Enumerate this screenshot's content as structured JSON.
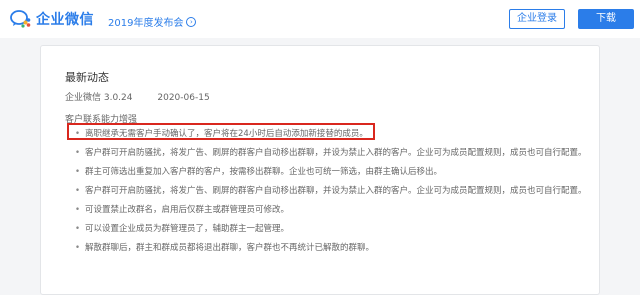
{
  "header": {
    "logo_text": "企业微信",
    "year_link": "2019年度发布会",
    "login_label": "企业登录",
    "download_label": "下载"
  },
  "card": {
    "title": "最新动态",
    "version": "企业微信 3.0.24",
    "date": "2020-06-15",
    "section": "客户联系能力增强",
    "items": [
      "离职继承无需客户手动确认了，客户将在24小时后自动添加新接替的成员。",
      "客户群可开启防骚扰，将发广告、刷屏的群客户自动移出群聊，并设为禁止入群的客户。企业可为成员配置规则，成员也可自行配置。",
      "群主可筛选出重复加入客户群的客户，按需移出群聊。企业也可统一筛选，由群主确认后移出。",
      "客户群可开启防骚扰，将发广告、刷屏的群客户自动移出群聊，并设为禁止入群的客户。企业可为成员配置规则，成员也可自行配置。",
      "可设置禁止改群名，启用后仅群主或群管理员可修改。",
      "可以设置企业成员为群管理员了，辅助群主一起管理。",
      "解散群聊后，群主和群成员都将退出群聊，客户群也不再统计已解散的群聊。"
    ]
  },
  "colors": {
    "brand": "#2b7de9",
    "highlight": "#d9271e"
  }
}
